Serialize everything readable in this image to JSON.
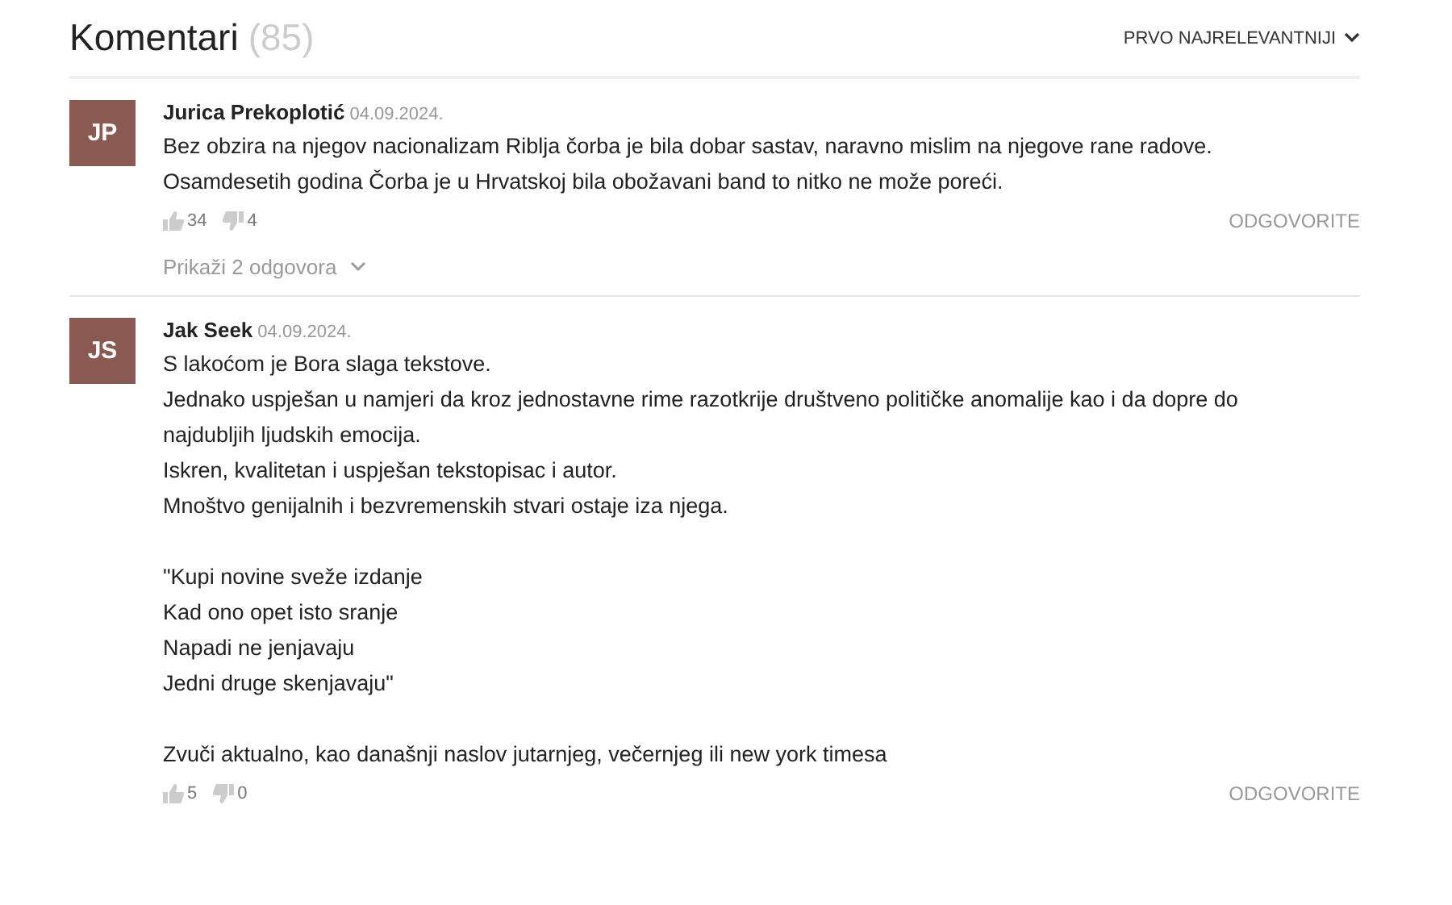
{
  "header": {
    "title": "Komentari",
    "count": "(85)",
    "sort": "PRVO NAJRELEVANTNIJI"
  },
  "comments": [
    {
      "initials": "JP",
      "author": "Jurica Prekoplotić",
      "date": "04.09.2024.",
      "paragraphs": [
        "Bez obzira na njegov nacionalizam Riblja čorba je bila dobar sastav, naravno mislim na njegove rane radove. Osamdesetih godina Čorba je u Hrvatskoj bila obožavani band to nitko ne može poreći."
      ],
      "likes": "34",
      "dislikes": "4",
      "reply": "ODGOVORITE",
      "replies": "Prikaži 2 odgovora"
    },
    {
      "initials": "JS",
      "author": "Jak Seek",
      "date": "04.09.2024.",
      "paragraphs": [
        "S lakoćom je Bora slaga tekstove.\nJednako uspješan u namjeri da kroz jednostavne rime razotkrije društveno političke anomalije kao i da dopre do najdubljih ljudskih emocija.\nIskren, kvalitetan i uspješan tekstopisac i autor.\nMnoštvo genijalnih i bezvremenskih stvari ostaje iza njega.",
        "\"Kupi novine sveže izdanje\nKad ono opet isto sranje\nNapadi ne jenjavaju\nJedni druge skenjavaju\"",
        "Zvuči aktualno, kao današnji naslov jutarnjeg, večernjeg ili new york timesa"
      ],
      "likes": "5",
      "dislikes": "0",
      "reply": "ODGOVORITE"
    }
  ]
}
